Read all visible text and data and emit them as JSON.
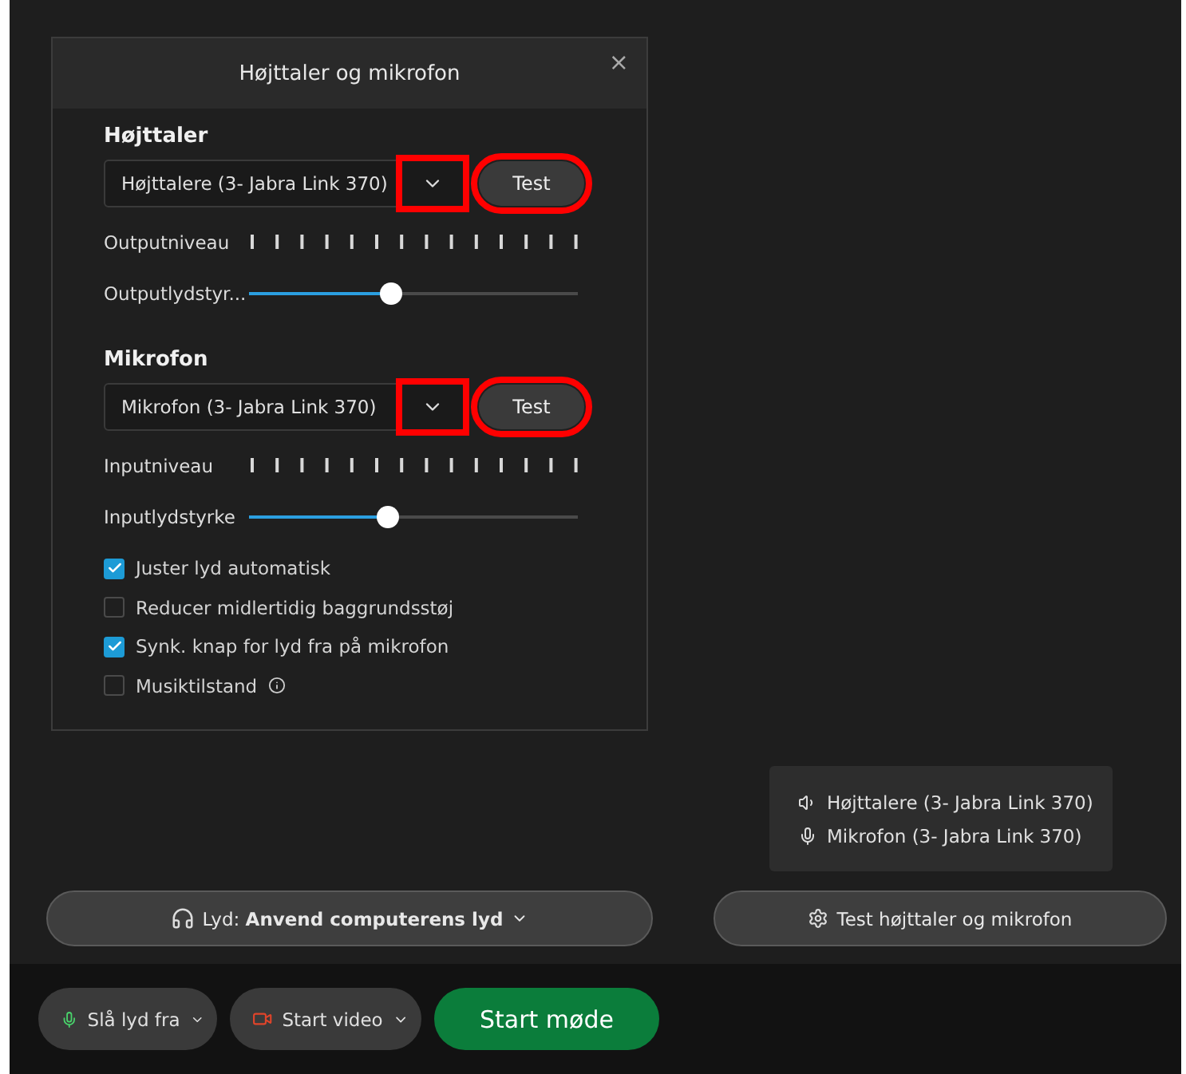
{
  "dialog": {
    "title": "Højttaler og mikrofon",
    "close": "×",
    "sections": [
      {
        "heading": "Højttaler",
        "device": "Højttalere (3- Jabra Link 370)",
        "test": "Test",
        "highlighted": true,
        "meter_label": "Outputniveau",
        "volume_label": "Outputlydstyr...",
        "volume": {
          "level": 0.43
        }
      },
      {
        "heading": "Mikrofon",
        "device": "Mikrofon (3- Jabra Link 370)",
        "test": "Test",
        "highlighted": true,
        "meter_label": "Inputniveau",
        "volume_label": "Inputlydstyrke",
        "volume": {
          "level": 0.42
        }
      }
    ],
    "options": [
      {
        "label": "Juster lyd automatisk",
        "checked": true
      },
      {
        "label": "Reducer midlertidig baggrundsstøj",
        "checked": false
      },
      {
        "label": "Synk. knap for lyd fra på mikrofon",
        "checked": true
      },
      {
        "label": "Musiktilstand",
        "checked": false,
        "info": true
      }
    ]
  },
  "devices_tooltip": [
    {
      "kind": "speaker",
      "label": "Højttalere (3- Jabra Link 370)"
    },
    {
      "kind": "microphone",
      "label": "Mikrofon (3- Jabra Link 370)"
    }
  ],
  "audio_button": "Lyd: **Anvend computerens lyd**",
  "test_button": "Test højttaler og mikrofon",
  "toolbar": {
    "mute": "Slå lyd fra",
    "video": "Start video",
    "start": "Start møde"
  }
}
